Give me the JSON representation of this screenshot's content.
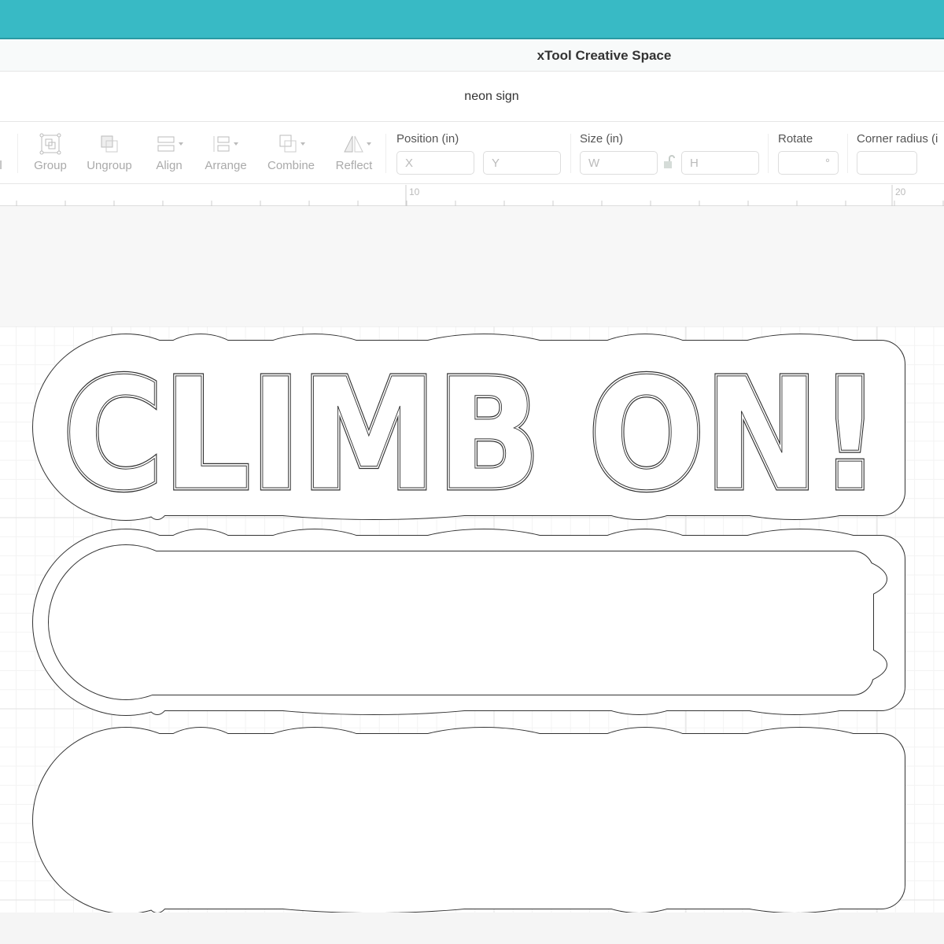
{
  "app": {
    "title": "xTool Creative Space",
    "accent": "#38bac5"
  },
  "document": {
    "name": "neon sign"
  },
  "toolbar": {
    "partial_label": "ll",
    "tools": [
      {
        "id": "group",
        "label": "Group",
        "icon": "group-icon"
      },
      {
        "id": "ungroup",
        "label": "Ungroup",
        "icon": "ungroup-icon"
      },
      {
        "id": "align",
        "label": "Align",
        "icon": "align-icon"
      },
      {
        "id": "arrange",
        "label": "Arrange",
        "icon": "arrange-icon"
      },
      {
        "id": "combine",
        "label": "Combine",
        "icon": "combine-icon"
      },
      {
        "id": "reflect",
        "label": "Reflect",
        "icon": "reflect-icon"
      }
    ],
    "position": {
      "label": "Position (in)",
      "x_placeholder": "X",
      "y_placeholder": "Y"
    },
    "size": {
      "label": "Size (in)",
      "w_placeholder": "W",
      "h_placeholder": "H"
    },
    "rotate": {
      "label": "Rotate",
      "unit": "°"
    },
    "corner_radius": {
      "label": "Corner radius (i"
    }
  },
  "ruler": {
    "labels": [
      "10",
      "20"
    ]
  },
  "design": {
    "text": "CLIMB ON!"
  }
}
